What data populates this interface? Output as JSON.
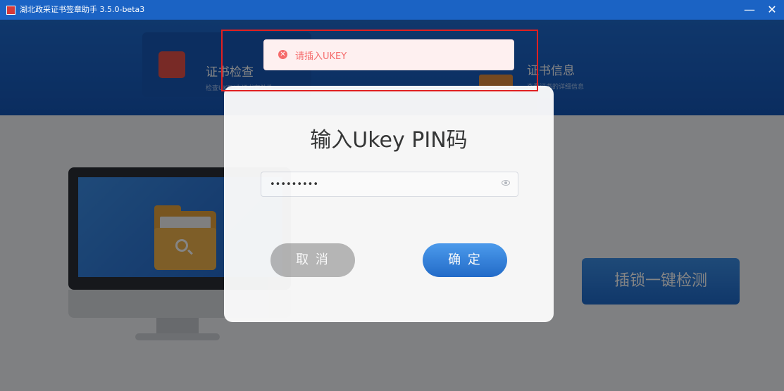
{
  "window": {
    "title": "湖北政采证书签章助手  3.5.0-beta3",
    "minimize_glyph": "—",
    "close_glyph": "✕"
  },
  "header": {
    "cards": [
      {
        "title": "证书检查",
        "subtitle": "检查UKEY中证书有效性",
        "icon": "search-plus-icon"
      },
      {
        "title": "证书信息",
        "subtitle": "查看证书的详细信息",
        "icon": "certificate-icon"
      }
    ]
  },
  "main": {
    "detect_button": "插锁一键检测"
  },
  "dialog": {
    "title": "输入Ukey PIN码",
    "pin_value": "•••••••••",
    "cancel_label": "取 消",
    "ok_label": "确 定"
  },
  "toast": {
    "message": "请插入UKEY",
    "icon_glyph": "✕",
    "color": "#f56c6c"
  },
  "colors": {
    "brand": "#1b63c4",
    "accent_button": "#1f6acb",
    "highlight": "#e02020"
  }
}
